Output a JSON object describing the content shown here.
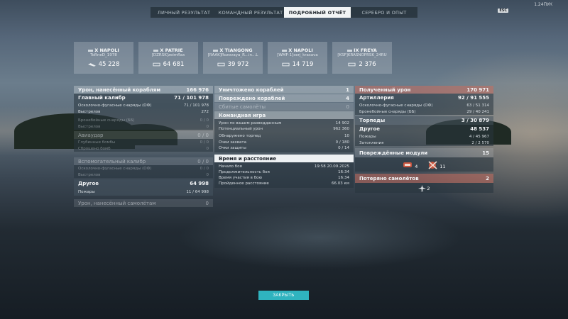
{
  "app": {
    "version": "1.24ПУК",
    "esc_label": "ESC"
  },
  "tabs": [
    {
      "label": "ЛИЧНЫЙ РЕЗУЛЬТАТ"
    },
    {
      "label": "КОМАНДНЫЙ РЕЗУЛЬТАТ"
    },
    {
      "label": "ПОДРОБНЫЙ ОТЧЁТ",
      "active": true
    },
    {
      "label": "СЕРЕБРО И ОПЫТ"
    }
  ],
  "ships": [
    {
      "name": "X NAPOLI",
      "player": "ToRneD_1978",
      "damage": "45 228"
    },
    {
      "name": "X PATRIE",
      "player": "[DZRSK]zeimflax",
      "damage": "64 681"
    },
    {
      "name": "X TIANGONG",
      "player": "[RAAK]Rozovaya_R...in...L",
      "damage": "39 972"
    },
    {
      "name": "X NAPOLI",
      "player": "[WMF-1]serj_krasava",
      "damage": "14 719"
    },
    {
      "name": "IX FREYA",
      "player": "[KSF]KRASNOPRSK_24RU",
      "damage": "2 376"
    }
  ],
  "left": {
    "damage_to_ships": {
      "label": "Урон, нанесённый кораблям",
      "value": "166 976"
    },
    "main_battery": {
      "label": "Главный калибр",
      "value": "71 / 101 978"
    },
    "main_rows": [
      {
        "label": "Осколочно-фугасные снаряды (ОФ)",
        "value": "71 / 101 978"
      },
      {
        "label": "Выстрелов",
        "value": "272"
      }
    ],
    "ap_rows": [
      {
        "label": "Бронебойные снаряды (ББ)",
        "value": "0 / 0"
      },
      {
        "label": "Выстрелов",
        "value": "0"
      }
    ],
    "aircraft": {
      "label": "Авиаудар",
      "value": "0 / 0"
    },
    "aircraft_rows": [
      {
        "label": "Глубинные бомбы",
        "value": "0 / 0"
      },
      {
        "label": "Сброшено бомб",
        "value": "0"
      }
    ],
    "secondary": {
      "label": "Вспомогательный калибр",
      "value": "0 / 0"
    },
    "secondary_rows": [
      {
        "label": "Осколочно-фугасные снаряды (ОФ)",
        "value": "0 / 0"
      },
      {
        "label": "Выстрелов",
        "value": "0"
      }
    ],
    "other": {
      "label": "Другое",
      "value": "64 998"
    },
    "other_rows": [
      {
        "label": "Пожары",
        "value": "11 / 64 998"
      }
    ],
    "plane_damage": {
      "label": "Урон, нанесённый самолётам",
      "value": "0"
    }
  },
  "middle": {
    "destroyed": {
      "label": "Уничтожено кораблей",
      "value": "1"
    },
    "damaged": {
      "label": "Повреждено кораблей",
      "value": "4"
    },
    "planes_shot": {
      "label": "Сбитые самолёты",
      "value": "0"
    },
    "team": {
      "label": "Командная игра"
    },
    "team_rows": [
      {
        "label": "Урон по вашим разведданным",
        "value": "14 902"
      },
      {
        "label": "Потенциальный урон",
        "value": "962 360"
      },
      {
        "label": "Обнаружено торпед",
        "value": "10"
      },
      {
        "label": "Очки захвата",
        "value": "0 / 180"
      },
      {
        "label": "Очки защиты",
        "value": "0 / 14"
      }
    ],
    "time": {
      "label": "Время и расстояние"
    },
    "time_rows": [
      {
        "label": "Начало боя",
        "value": "19:58  20.09.2025"
      },
      {
        "label": "Продолжительность боя",
        "value": "16:34"
      },
      {
        "label": "Время участия в бою",
        "value": "16:34"
      },
      {
        "label": "Пройденное расстояние",
        "value": "66.03 км"
      }
    ]
  },
  "right": {
    "received": {
      "label": "Полученный урон",
      "value": "170 971"
    },
    "artillery": {
      "label": "Артиллерия",
      "value": "92 / 91 555"
    },
    "art_rows": [
      {
        "label": "Осколочно-фугасные снаряды (ОФ)",
        "value": "63 / 51 314"
      },
      {
        "label": "Бронебойные снаряды (ББ)",
        "value": "29 / 40 241"
      }
    ],
    "torpedoes": {
      "label": "Торпеды",
      "value": "3 / 30 879"
    },
    "other": {
      "label": "Другое",
      "value": "48 537"
    },
    "other_rows": [
      {
        "label": "Пожары",
        "value": "4 / 45 967"
      },
      {
        "label": "Затопления",
        "value": "2 / 2 570"
      }
    ],
    "modules": {
      "label": "Повреждённые модули",
      "value": "15"
    },
    "module_counts": [
      {
        "count": "4"
      },
      {
        "count": "11"
      }
    ],
    "planes_lost": {
      "label": "Потеряно самолётов",
      "value": "2"
    },
    "planes_lost_count": "2"
  },
  "close_label": "ЗАКРЫТЬ"
}
